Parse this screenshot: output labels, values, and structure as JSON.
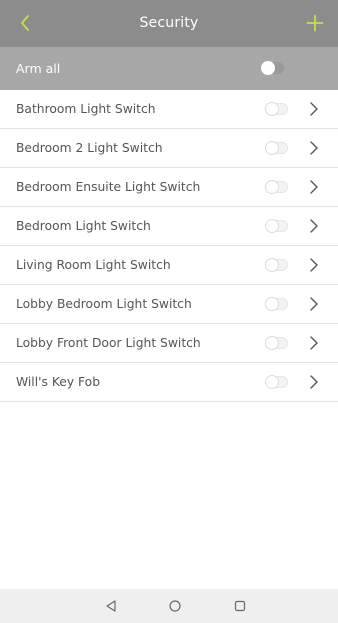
{
  "header": {
    "title": "Security",
    "back_icon": "chevron-left-icon",
    "add_icon": "plus-icon",
    "accent_color": "#c6e04a"
  },
  "arm_all": {
    "label": "Arm all",
    "toggle_on": false
  },
  "devices": [
    {
      "name": "Bathroom Light Switch",
      "armed": false
    },
    {
      "name": "Bedroom 2 Light Switch",
      "armed": false
    },
    {
      "name": "Bedroom Ensuite Light Switch",
      "armed": false
    },
    {
      "name": "Bedroom Light Switch",
      "armed": false
    },
    {
      "name": "Living Room Light Switch",
      "armed": false
    },
    {
      "name": "Lobby Bedroom Light Switch",
      "armed": false
    },
    {
      "name": "Lobby Front Door Light Switch",
      "armed": false
    },
    {
      "name": "Will's Key Fob",
      "armed": false
    }
  ],
  "navbar": {
    "back_icon": "triangle-back-icon",
    "home_icon": "circle-home-icon",
    "recents_icon": "square-recents-icon"
  }
}
